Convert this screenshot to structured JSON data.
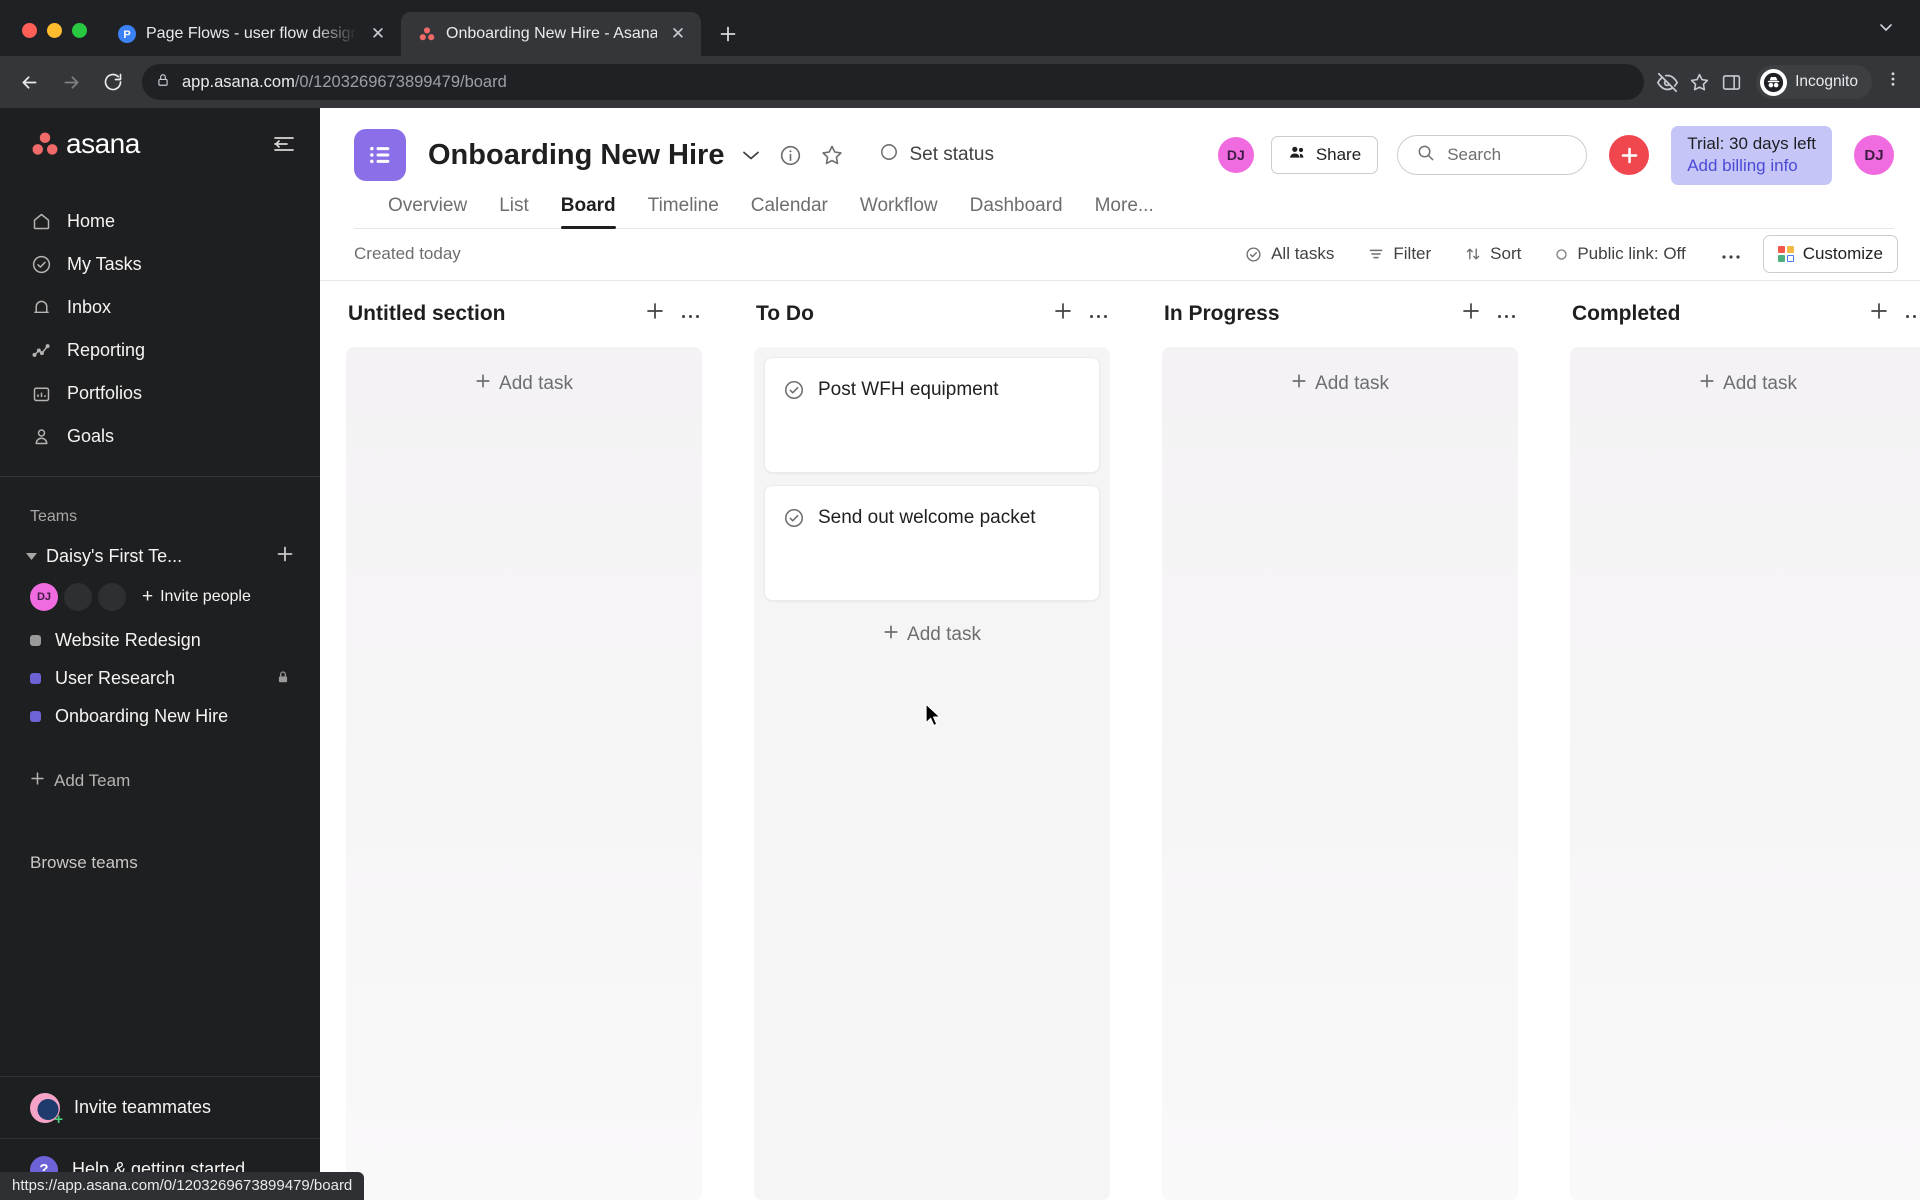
{
  "browser": {
    "tabs": [
      {
        "title": "Page Flows - user flow design",
        "favicon": "pageflows-p-icon",
        "active": false
      },
      {
        "title": "Onboarding New Hire - Asana",
        "favicon": "asana-icon",
        "active": true
      }
    ],
    "new_tab_label": "+",
    "window_chevron": "⌄",
    "nav": {
      "back": "back-arrow",
      "forward": "forward-arrow",
      "reload": "reload-icon"
    },
    "omnibox": {
      "lock": "lock-icon",
      "url_bold": "app.asana.com",
      "url_dim": "/0/1203269673899479/board"
    },
    "actions": [
      "eye-slash-icon",
      "star-icon",
      "side-panel-icon"
    ],
    "profile_label": "Incognito",
    "menu": "three-dot-menu-icon"
  },
  "status_bar": {
    "url": "https://app.asana.com/0/1203269673899479/board"
  },
  "sidebar": {
    "brand": "asana",
    "collapse_icon": "collapse-sidebar-icon",
    "nav_items": [
      {
        "label": "Home",
        "icon": "home-icon"
      },
      {
        "label": "My Tasks",
        "icon": "check-circle-icon"
      },
      {
        "label": "Inbox",
        "icon": "bell-icon"
      },
      {
        "label": "Reporting",
        "icon": "line-chart-icon"
      },
      {
        "label": "Portfolios",
        "icon": "portfolio-icon"
      },
      {
        "label": "Goals",
        "icon": "goal-person-icon"
      }
    ],
    "teams_label": "Teams",
    "team": {
      "name": "Daisy's First Te...",
      "add_label": "+",
      "caret": "▼"
    },
    "members": {
      "avatar_initials": "DJ",
      "empty_count": 2,
      "invite_label": "Invite people"
    },
    "projects": [
      {
        "name": "Website Redesign",
        "color": "#9a9a9a",
        "locked": false
      },
      {
        "name": "User Research",
        "color": "#6e63d6",
        "locked": true
      },
      {
        "name": "Onboarding New Hire",
        "color": "#6e63d6",
        "locked": false
      }
    ],
    "add_team_label": "Add Team",
    "browse_teams_label": "Browse teams",
    "invite_teammates_label": "Invite teammates",
    "help_label": "Help & getting started",
    "help_badge": "?"
  },
  "project": {
    "icon": "list-board-icon",
    "title": "Onboarding New Hire",
    "chevron": "⌄",
    "info_icon": "info-icon",
    "star_icon": "star-outline-icon",
    "set_status_label": "Set status",
    "header_avatar_initials": "DJ",
    "share_label": "Share",
    "search_placeholder": "Search",
    "add_button": "+",
    "trial_line1": "Trial: 30 days left",
    "trial_line2": "Add billing info",
    "user_avatar_initials": "DJ",
    "tabs": [
      {
        "label": "Overview",
        "active": false
      },
      {
        "label": "List",
        "active": false
      },
      {
        "label": "Board",
        "active": true
      },
      {
        "label": "Timeline",
        "active": false
      },
      {
        "label": "Calendar",
        "active": false
      },
      {
        "label": "Workflow",
        "active": false
      },
      {
        "label": "Dashboard",
        "active": false
      },
      {
        "label": "More...",
        "active": false
      }
    ]
  },
  "toolbar": {
    "created_today": "Created today",
    "all_tasks_label": "All tasks",
    "filter_label": "Filter",
    "sort_label": "Sort",
    "public_link_label": "Public link: Off",
    "more_dots": "···",
    "customize_label": "Customize",
    "customize_colors": [
      "#f5564a",
      "#f2b844",
      "#4caf7d",
      "#4a7cf5"
    ]
  },
  "board": {
    "add_task_label": "Add task",
    "columns": [
      {
        "title": "Untitled section",
        "plus": "+",
        "dots": "···",
        "tasks": []
      },
      {
        "title": "To Do",
        "plus": "+",
        "dots": "···",
        "tasks": [
          {
            "title": "Post WFH equipment",
            "status_icon": "check-circle-icon"
          },
          {
            "title": "Send out welcome packet",
            "status_icon": "check-circle-icon"
          }
        ]
      },
      {
        "title": "In Progress",
        "plus": "+",
        "dots": "···",
        "tasks": []
      },
      {
        "title": "Completed",
        "plus": "+",
        "dots": "···",
        "tasks": []
      }
    ]
  },
  "colors": {
    "asana_red": "#f06a6a",
    "accent_purple": "#8b6fe8",
    "trial_bg": "#c5c6f7",
    "trial_link": "#4b4ad6",
    "add_button": "#f0474f",
    "avatar_pink": "#f06ae0"
  }
}
